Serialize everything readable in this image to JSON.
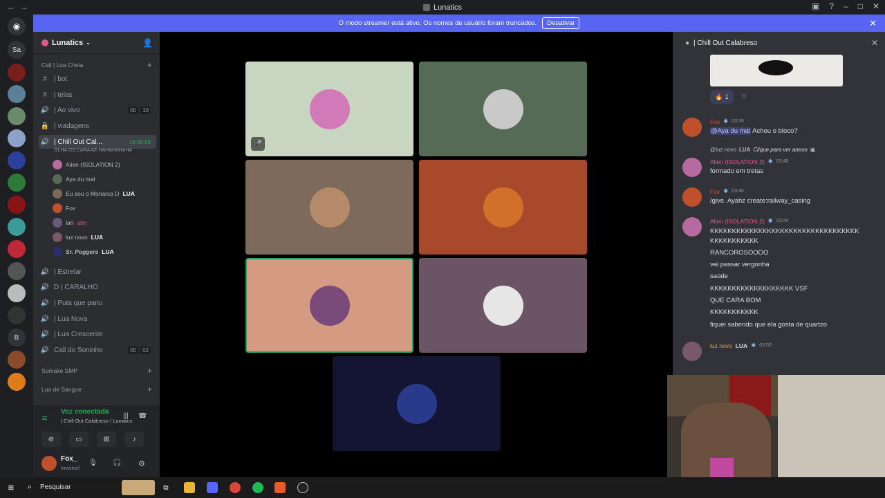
{
  "window": {
    "title": "Lunatics",
    "nav_back": "←",
    "nav_fwd": "→"
  },
  "banner": {
    "message": "O modo streamer está ativo. Os nomes de usuário foram truncados.",
    "button": "Desativar"
  },
  "servers": [
    "Sa",
    "B"
  ],
  "guild": {
    "name": "Lunatics"
  },
  "channels": {
    "category_top": "Call | Lua Cheia",
    "items": [
      {
        "icon": "#",
        "name": "| bot"
      },
      {
        "icon": "#",
        "name": "| telas"
      },
      {
        "icon": "🔊",
        "name": "| Ao vivo",
        "c1": "00",
        "c2": "10"
      },
      {
        "icon": "🔒",
        "name": "| viadagens"
      },
      {
        "icon": "🔊",
        "name": "| Chill Out Cal...",
        "time": "16:05:59",
        "sub": "OLHA OS CARA AE HAHAHAHAHA"
      },
      {
        "icon": "🔊",
        "name": "| Estrelar"
      },
      {
        "icon": "🔊",
        "name": "D | CARALHO"
      },
      {
        "icon": "🔊",
        "name": "| Puta que pariu"
      },
      {
        "icon": "🔊",
        "name": "| Lua Nova"
      },
      {
        "icon": "🔊",
        "name": "| Lua Crescente"
      },
      {
        "icon": "🔊",
        "name": "Call do Soninho",
        "c1": "00",
        "c2": "02"
      }
    ],
    "members": [
      "Alien (ISOLATION 2)",
      "Aya du mal",
      "Eu sou o Monarca D",
      "Fox",
      "lari",
      "luz novo",
      "Sr. Poggers"
    ],
    "member_tags": {
      "monarca": "LUA",
      "lari": "ahri",
      "luz": "LUA",
      "poggers": "LUA"
    },
    "category2": "Somake SMP",
    "category3": "Lua de Sangue"
  },
  "voice": {
    "status": "Voz conectada",
    "channel": "| Chill Out Calabreso / Lunatics"
  },
  "user": {
    "name": "Fox_",
    "status": "Invisível"
  },
  "chat": {
    "header": "| Chill Out Calabreso",
    "reaction_count": "1",
    "messages": [
      {
        "author": "Fox",
        "time": "03:39",
        "mention": "@Aya du mal",
        "text": "Achou o bloco?"
      },
      {
        "reply": "@luz novo",
        "reply_tag": "LUA",
        "reply_text": "Clique para ver anexo"
      },
      {
        "author": "Alien (ISOLATION 2)",
        "time": "03:40",
        "text": "formado em tretas"
      },
      {
        "author": "Fox",
        "time": "03:40",
        "text": "/give. Ayahz create:railway_casing"
      },
      {
        "author": "Alien (ISOLATION 2)",
        "time": "03:44",
        "lines": [
          "KKKKKKKKKKKKKKKKKKKKKKKKKKKKKKKKKK",
          "KKKKKKKKKKK",
          "RANCOROSOOOO",
          "vai passar vergonha",
          "saúde",
          "KKKKKKKKKKKKKKKKKKK VSF",
          "QUE CARA BOM",
          "KKKKKKKKKKK",
          "fiquei sabendo que ela gosta de quartzo"
        ]
      },
      {
        "author": "luz novo",
        "tag": "LUA",
        "time": "03:50"
      }
    ]
  },
  "taskbar": {
    "search": "Pesquisar"
  },
  "colors": {
    "accent": "#5865f2",
    "green": "#23a55a",
    "red_name": "#f23f43",
    "pink_name": "#e05a85"
  }
}
